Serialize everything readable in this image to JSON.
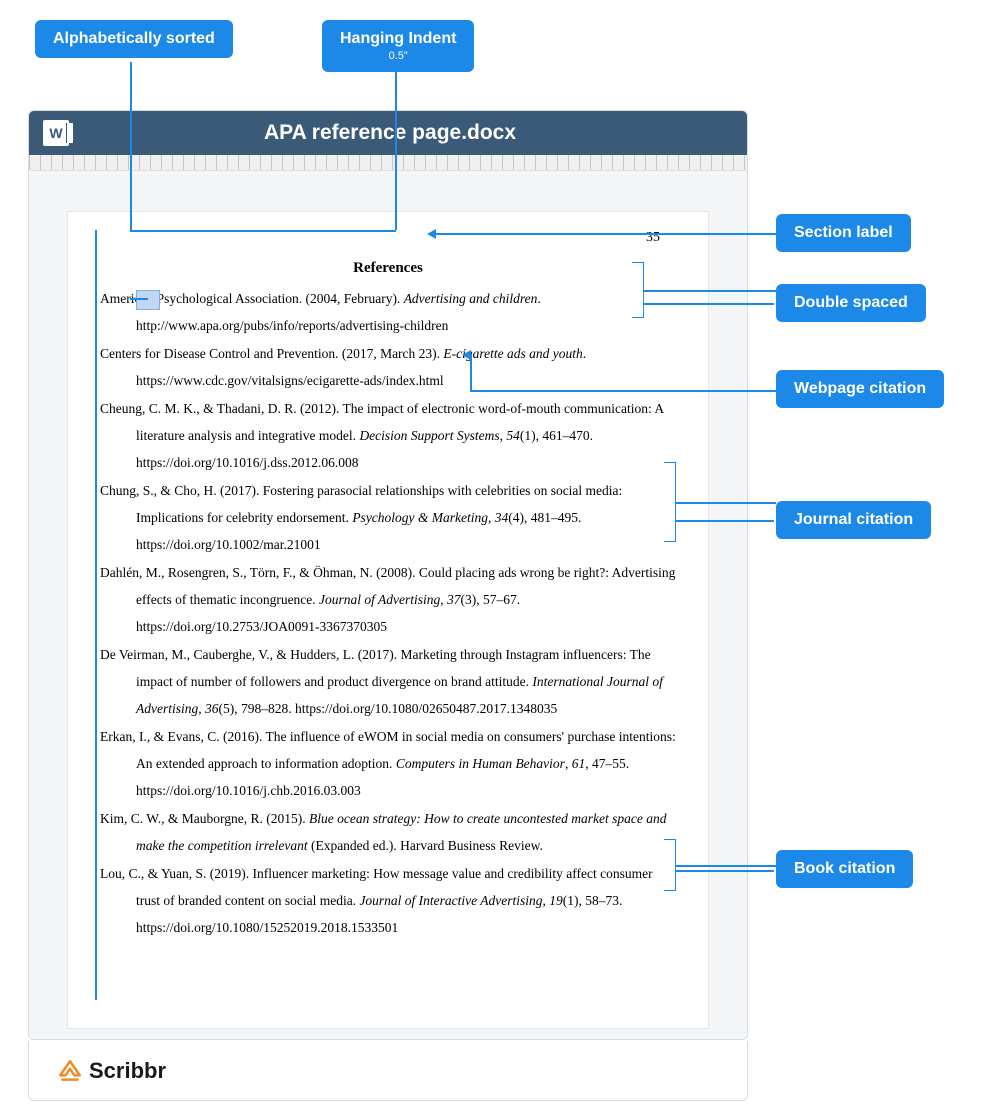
{
  "callouts": {
    "alpha_sorted": "Alphabetically sorted",
    "hanging_indent": "Hanging Indent",
    "hanging_indent_sub": "0.5\"",
    "section_label": "Section label",
    "double_spaced": "Double spaced",
    "webpage_citation": "Webpage citation",
    "journal_citation": "Journal citation",
    "book_citation": "Book citation"
  },
  "document": {
    "title": "APA reference page.docx",
    "page_number": "35",
    "heading": "References",
    "entries": [
      {
        "pre": "American Psychological Association. (2004, February). ",
        "it1": "Advertising and children",
        "post1": ". http://www.apa.org/pubs/info/reports/advertising-children"
      },
      {
        "pre": "Centers for Disease Control and Prevention. (2017, March 23). ",
        "it1": "E-cigarette ads and youth",
        "post1": ". https://www.cdc.gov/vitalsigns/ecigarette-ads/index.html"
      },
      {
        "pre": "Cheung, C. M. K., & Thadani, D. R. (2012). The impact of electronic word-of-mouth communication: A literature analysis and integrative model. ",
        "it1": "Decision Support Systems",
        "post1": ", ",
        "it2": "54",
        "post2": "(1), 461–470. https://doi.org/10.1016/j.dss.2012.06.008"
      },
      {
        "pre": "Chung, S., & Cho, H. (2017). Fostering parasocial relationships with celebrities on social media: Implications for celebrity endorsement. ",
        "it1": "Psychology & Marketing",
        "post1": ", ",
        "it2": "34",
        "post2": "(4), 481–495. https://doi.org/10.1002/mar.21001"
      },
      {
        "pre": "Dahlén, M., Rosengren, S., Törn, F., & Öhman, N. (2008). Could placing ads wrong be right?: Advertising effects of thematic incongruence. ",
        "it1": "Journal of Advertising",
        "post1": ", ",
        "it2": "37",
        "post2": "(3), 57–67. https://doi.org/10.2753/JOA0091-3367370305"
      },
      {
        "pre": "De Veirman, M., Cauberghe, V., & Hudders, L. (2017). Marketing through Instagram influencers: The impact of number of followers and product divergence on brand attitude. ",
        "it1": "International Journal of Advertising",
        "post1": ", ",
        "it2": "36",
        "post2": "(5), 798–828. https://doi.org/10.1080/02650487.2017.1348035"
      },
      {
        "pre": "Erkan, I., & Evans, C. (2016). The influence of eWOM in social media on consumers' purchase intentions: An extended approach to information adoption. ",
        "it1": "Computers in Human Behavior",
        "post1": ", ",
        "it2": "61",
        "post2": ", 47–55. https://doi.org/10.1016/j.chb.2016.03.003"
      },
      {
        "pre": "Kim, C. W., & Mauborgne, R. (2015). ",
        "it1": "Blue ocean strategy: How to create uncontested market space and make the competition irrelevant",
        "post1": " (Expanded ed.). Harvard Business Review."
      },
      {
        "pre": "Lou, C., & Yuan, S. (2019). Influencer marketing: How message value and credibility affect consumer trust of branded content on social media. ",
        "it1": "Journal of Interactive Advertising",
        "post1": ", ",
        "it2": "19",
        "post2": "(1), 58–73. https://doi.org/10.1080/15252019.2018.1533501"
      }
    ]
  },
  "footer": {
    "brand": "Scribbr"
  }
}
